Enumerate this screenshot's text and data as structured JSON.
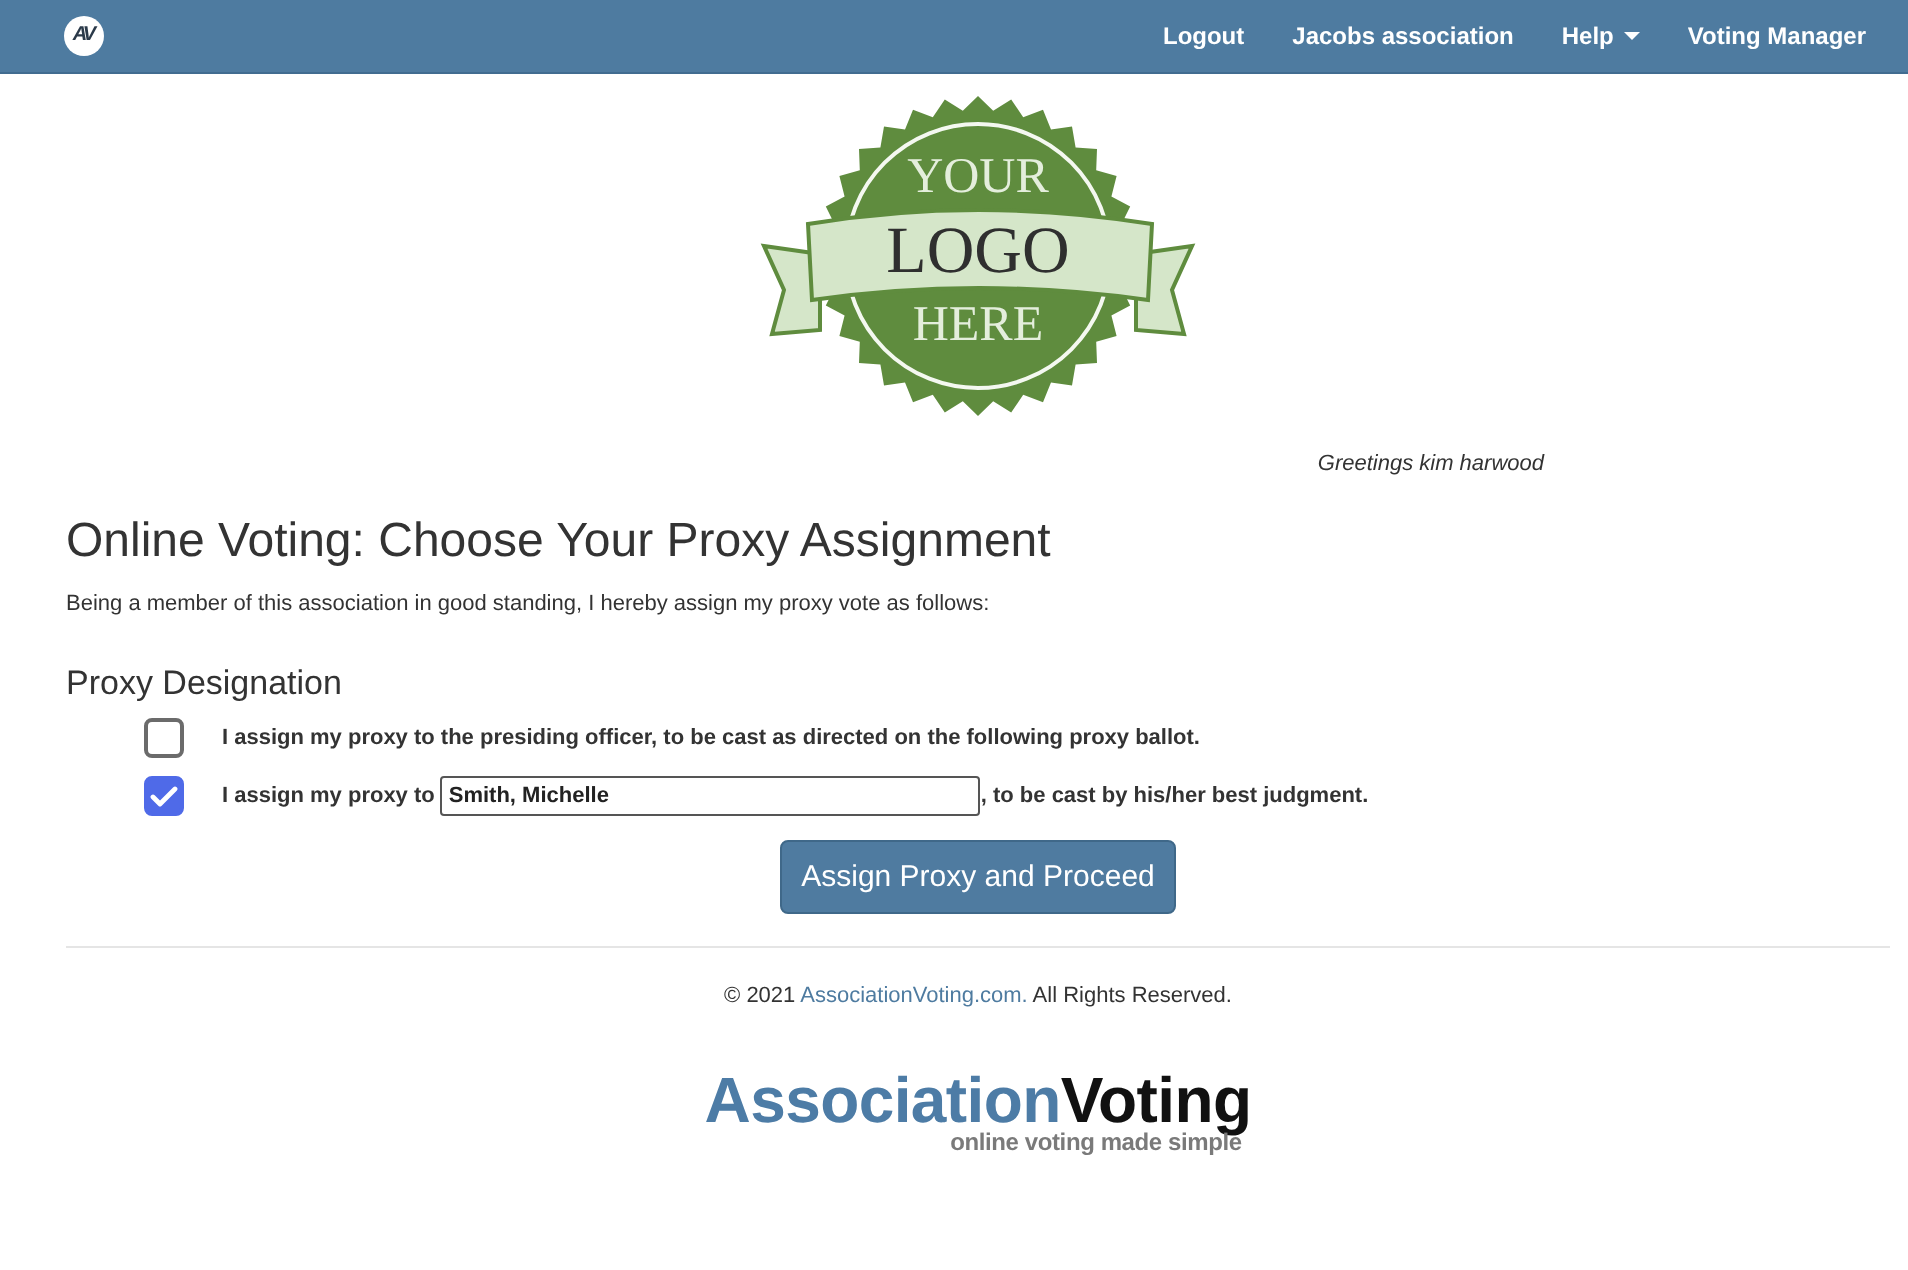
{
  "navbar": {
    "brand": "AV",
    "links": [
      {
        "label": "Logout",
        "dropdown": false
      },
      {
        "label": "Jacobs association",
        "dropdown": false
      },
      {
        "label": "Help",
        "dropdown": true
      },
      {
        "label": "Voting Manager",
        "dropdown": false
      }
    ]
  },
  "logo": {
    "lines": [
      "YOUR",
      "LOGO",
      "HERE"
    ]
  },
  "greeting": "Greetings kim harwood",
  "title": "Online Voting: Choose Your Proxy Assignment",
  "intro": "Being a member of this association in good standing, I hereby assign my proxy vote as follows:",
  "section_title": "Proxy Designation",
  "options": [
    {
      "kind": "plain",
      "checked": false,
      "label": "I assign my proxy to the presiding officer, to be cast as directed on the following proxy ballot."
    },
    {
      "kind": "named",
      "checked": true,
      "label_before": "I assign my proxy to",
      "value": "Smith, Michelle",
      "label_after": ", to be cast by his/her best judgment."
    }
  ],
  "submit_button": "Assign Proxy and Proceed",
  "footer": {
    "copyright_before": "© 2021",
    "link": "AssociationVoting.com.",
    "copyright_after": "All Rights Reserved."
  },
  "footer_logo": {
    "part_1": "Association",
    "part_2": "Voting",
    "tagline": "online voting made simple"
  }
}
